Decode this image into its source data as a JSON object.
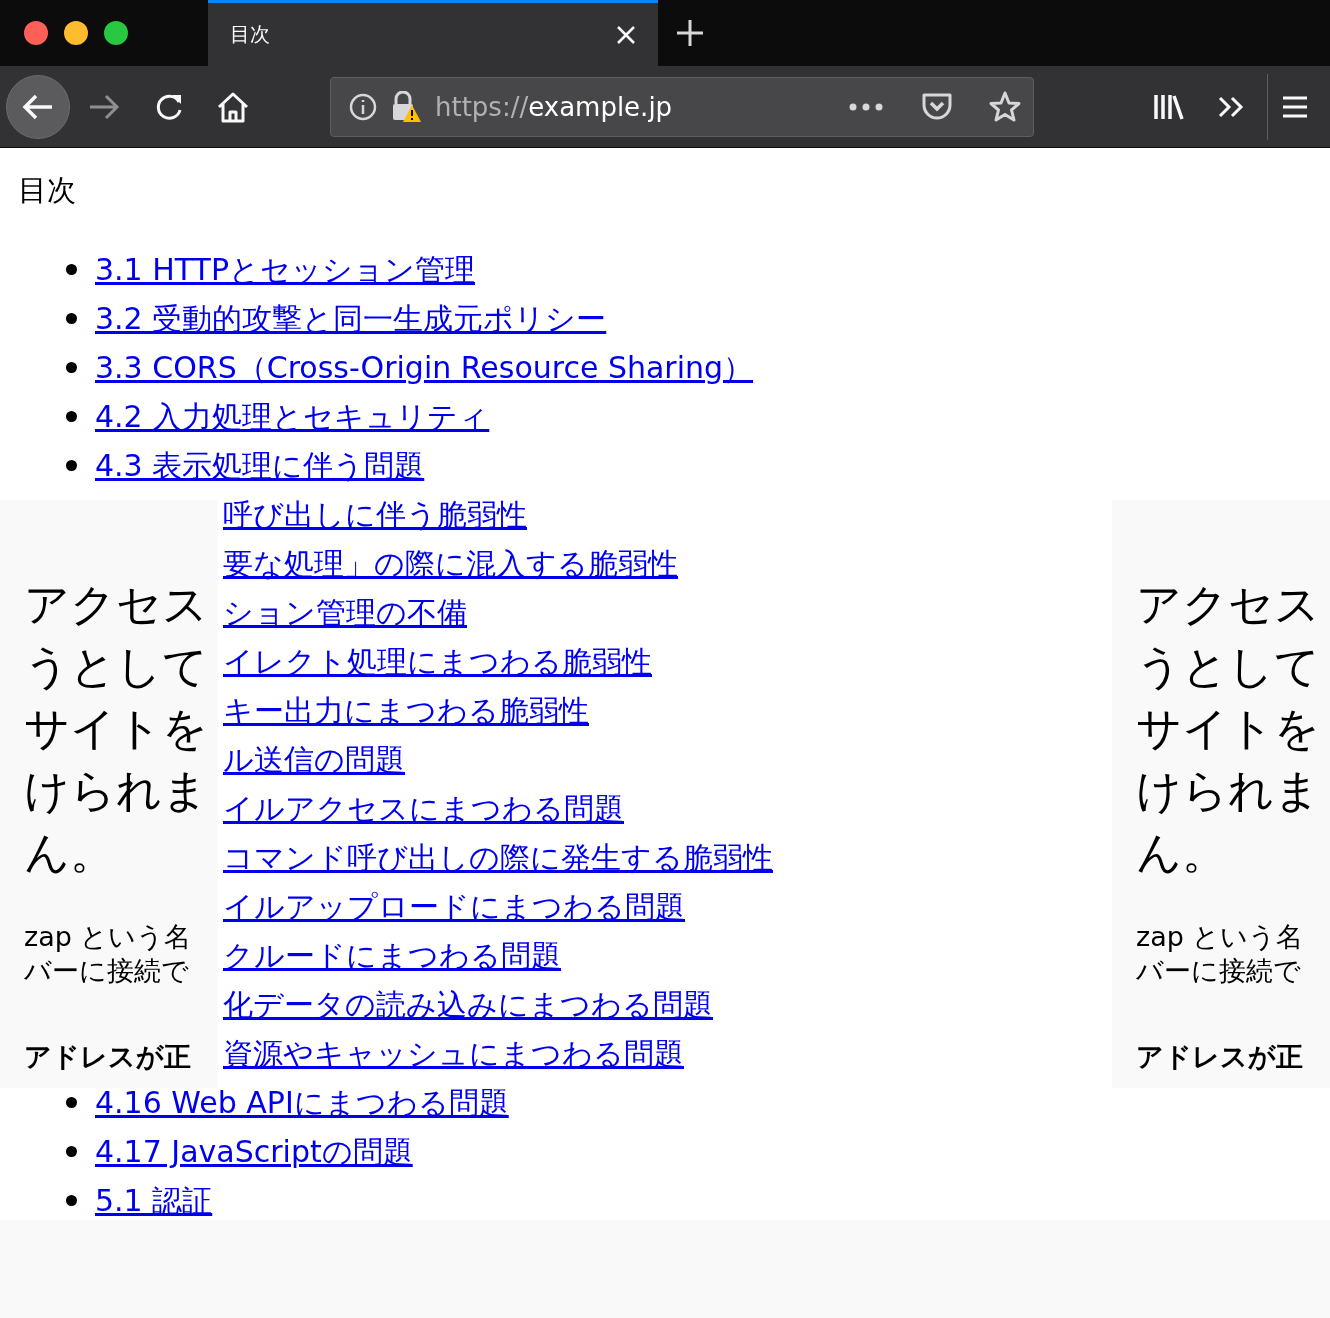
{
  "window": {
    "tab": {
      "title": "目次",
      "selected": true
    },
    "address_bar": {
      "scheme": "https://",
      "host": "example.jp"
    }
  },
  "page": {
    "heading": "目次",
    "toc": [
      {
        "kind": "item",
        "text": "3.1 HTTPとセッション管理"
      },
      {
        "kind": "item",
        "text": "3.2 受動的攻撃と同一生成元ポリシー"
      },
      {
        "kind": "item",
        "text": "3.3 CORS（Cross-Origin Resource Sharing）"
      },
      {
        "kind": "item",
        "text": "4.2 入力処理とセキュリティ"
      },
      {
        "kind": "item",
        "text": "4.3 表示処理に伴う問題"
      },
      {
        "kind": "fragment",
        "text": "呼び出しに伴う脆弱性"
      },
      {
        "kind": "fragment",
        "text": "要な処理」の際に混入する脆弱性"
      },
      {
        "kind": "fragment",
        "text": "ション管理の不備"
      },
      {
        "kind": "fragment",
        "text": "イレクト処理にまつわる脆弱性"
      },
      {
        "kind": "fragment",
        "text": "キー出力にまつわる脆弱性"
      },
      {
        "kind": "fragment",
        "text": "ル送信の問題"
      },
      {
        "kind": "fragment",
        "text": "イルアクセスにまつわる問題"
      },
      {
        "kind": "fragment",
        "text": "コマンド呼び出しの際に発生する脆弱性"
      },
      {
        "kind": "fragment",
        "text": "イルアップロードにまつわる問題"
      },
      {
        "kind": "fragment",
        "text": "クルードにまつわる問題"
      },
      {
        "kind": "fragment",
        "text": "化データの読み込みにまつわる問題"
      },
      {
        "kind": "fragment",
        "text": "資源やキャッシュにまつわる問題"
      },
      {
        "kind": "item",
        "text": "4.16 Web APIにまつわる問題"
      },
      {
        "kind": "item",
        "text": "4.17 JavaScriptの問題"
      },
      {
        "kind": "item",
        "text": "5.1 認証"
      }
    ]
  },
  "error_panels": [
    {
      "heading_lines": [
        "アクセス",
        "うとして",
        "サイトを",
        "けられま",
        "ん。"
      ],
      "body_lines": [
        "zap という名",
        "バーに接続で"
      ],
      "bold_line": "アドレスが正"
    },
    {
      "heading_lines": [
        "アクセス",
        "うとして",
        "サイトを",
        "けられま",
        "ん。"
      ],
      "body_lines": [
        "zap という名",
        "バーに接続で"
      ],
      "bold_line": "アドレスが正"
    }
  ]
}
